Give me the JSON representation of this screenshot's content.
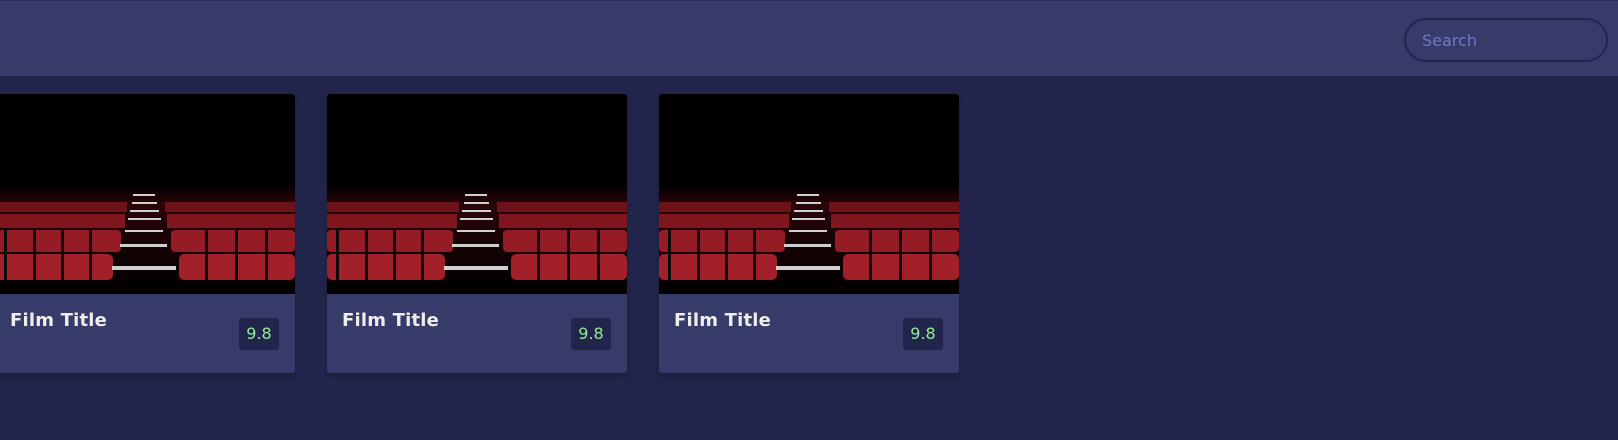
{
  "header": {
    "search": {
      "placeholder": "Search"
    }
  },
  "movies": [
    {
      "title": "Film Title",
      "rating": "9.8",
      "poster_icon": "cinema-seats-image"
    },
    {
      "title": "Film Title",
      "rating": "9.8",
      "poster_icon": "cinema-seats-image"
    },
    {
      "title": "Film Title",
      "rating": "9.8",
      "poster_icon": "cinema-seats-image"
    }
  ],
  "colors": {
    "background": "#22254b",
    "surface": "#373b69",
    "rating_text": "#90ee90",
    "seat_red": "#8e1a22"
  }
}
